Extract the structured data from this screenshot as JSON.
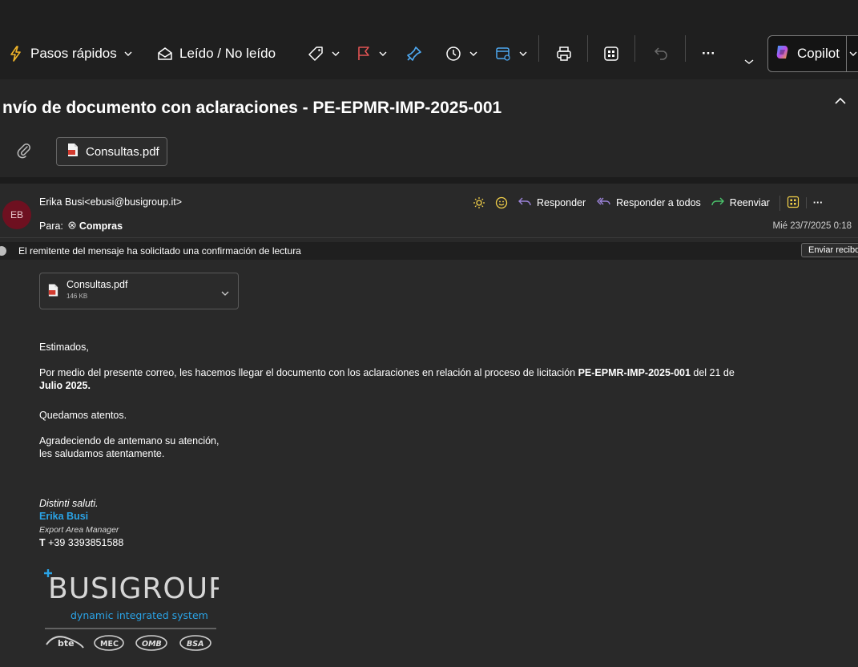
{
  "toolbar": {
    "quick_steps": "Pasos rápidos",
    "read_unread": "Leído / No leído",
    "more": "···",
    "copilot": "Copilot"
  },
  "email": {
    "subject": "nvío de documento con aclaraciones - PE-EPMR-IMP-2025-001",
    "attachment_chip": "Consultas.pdf",
    "avatar_initials": "EB",
    "sender": "Erika Busi<ebusi@busigroup.it>",
    "to_label": "Para:",
    "to_value": "Compras",
    "date": "Mié 23/7/2025 0:18",
    "actions": {
      "reply": "Responder",
      "reply_all": "Responder a todos",
      "forward": "Reenviar",
      "more": "···"
    },
    "read_receipt": {
      "text": "El remitente del mensaje ha solicitado una confirmación de lectura",
      "button": "Enviar recibo"
    },
    "attachment": {
      "name": "Consultas.pdf",
      "size": "146 KB"
    },
    "body": {
      "greeting": "Estimados,",
      "para_lead": "Por medio del presente correo, les hacemos llegar el documento con los aclaraciones en relación al proceso de licitación ",
      "para_bold": "PE-EPMR-IMP-2025-001",
      "para_tail_1": " del 21 de",
      "para_tail_2": "Julio 2025.",
      "line_attentive": "Quedamos atentos.",
      "thanks_1": "Agradeciendo de antemano su atención,",
      "thanks_2": "les saludamos atentamente."
    },
    "signature": {
      "closing": "Distinti saluti.",
      "name": "Erika Busi",
      "role": "Export Area Manager",
      "phone_label": "T",
      "phone": "+39 3393851588",
      "logo_text": "BUSIGROUP",
      "tagline": "dynamic integrated system",
      "brands": [
        "bte",
        "MEC",
        "OMB",
        "BSA"
      ]
    }
  },
  "colors": {
    "background": "#292929",
    "toolbar": "#1f1f1f",
    "accent_blue": "#2aa3e6",
    "flag_red": "#e05353",
    "pin_blue": "#4ea8f0",
    "highlight_yellow": "#f5d34a",
    "forward_green": "#4ac26b",
    "reply_purple": "#9b83d8",
    "avatar": "#6e1020"
  },
  "icons": [
    "lightning-icon",
    "chevron-down-icon",
    "envelope-open-icon",
    "tag-icon",
    "flag-icon",
    "pin-icon",
    "clock-icon",
    "move-folder-icon",
    "print-icon",
    "apps-icon",
    "undo-icon",
    "copilot-icon",
    "chevron-up-icon",
    "paperclip-icon",
    "pdf-icon",
    "sun-icon",
    "emoji-icon",
    "reply-icon",
    "reply-all-icon",
    "forward-icon"
  ]
}
